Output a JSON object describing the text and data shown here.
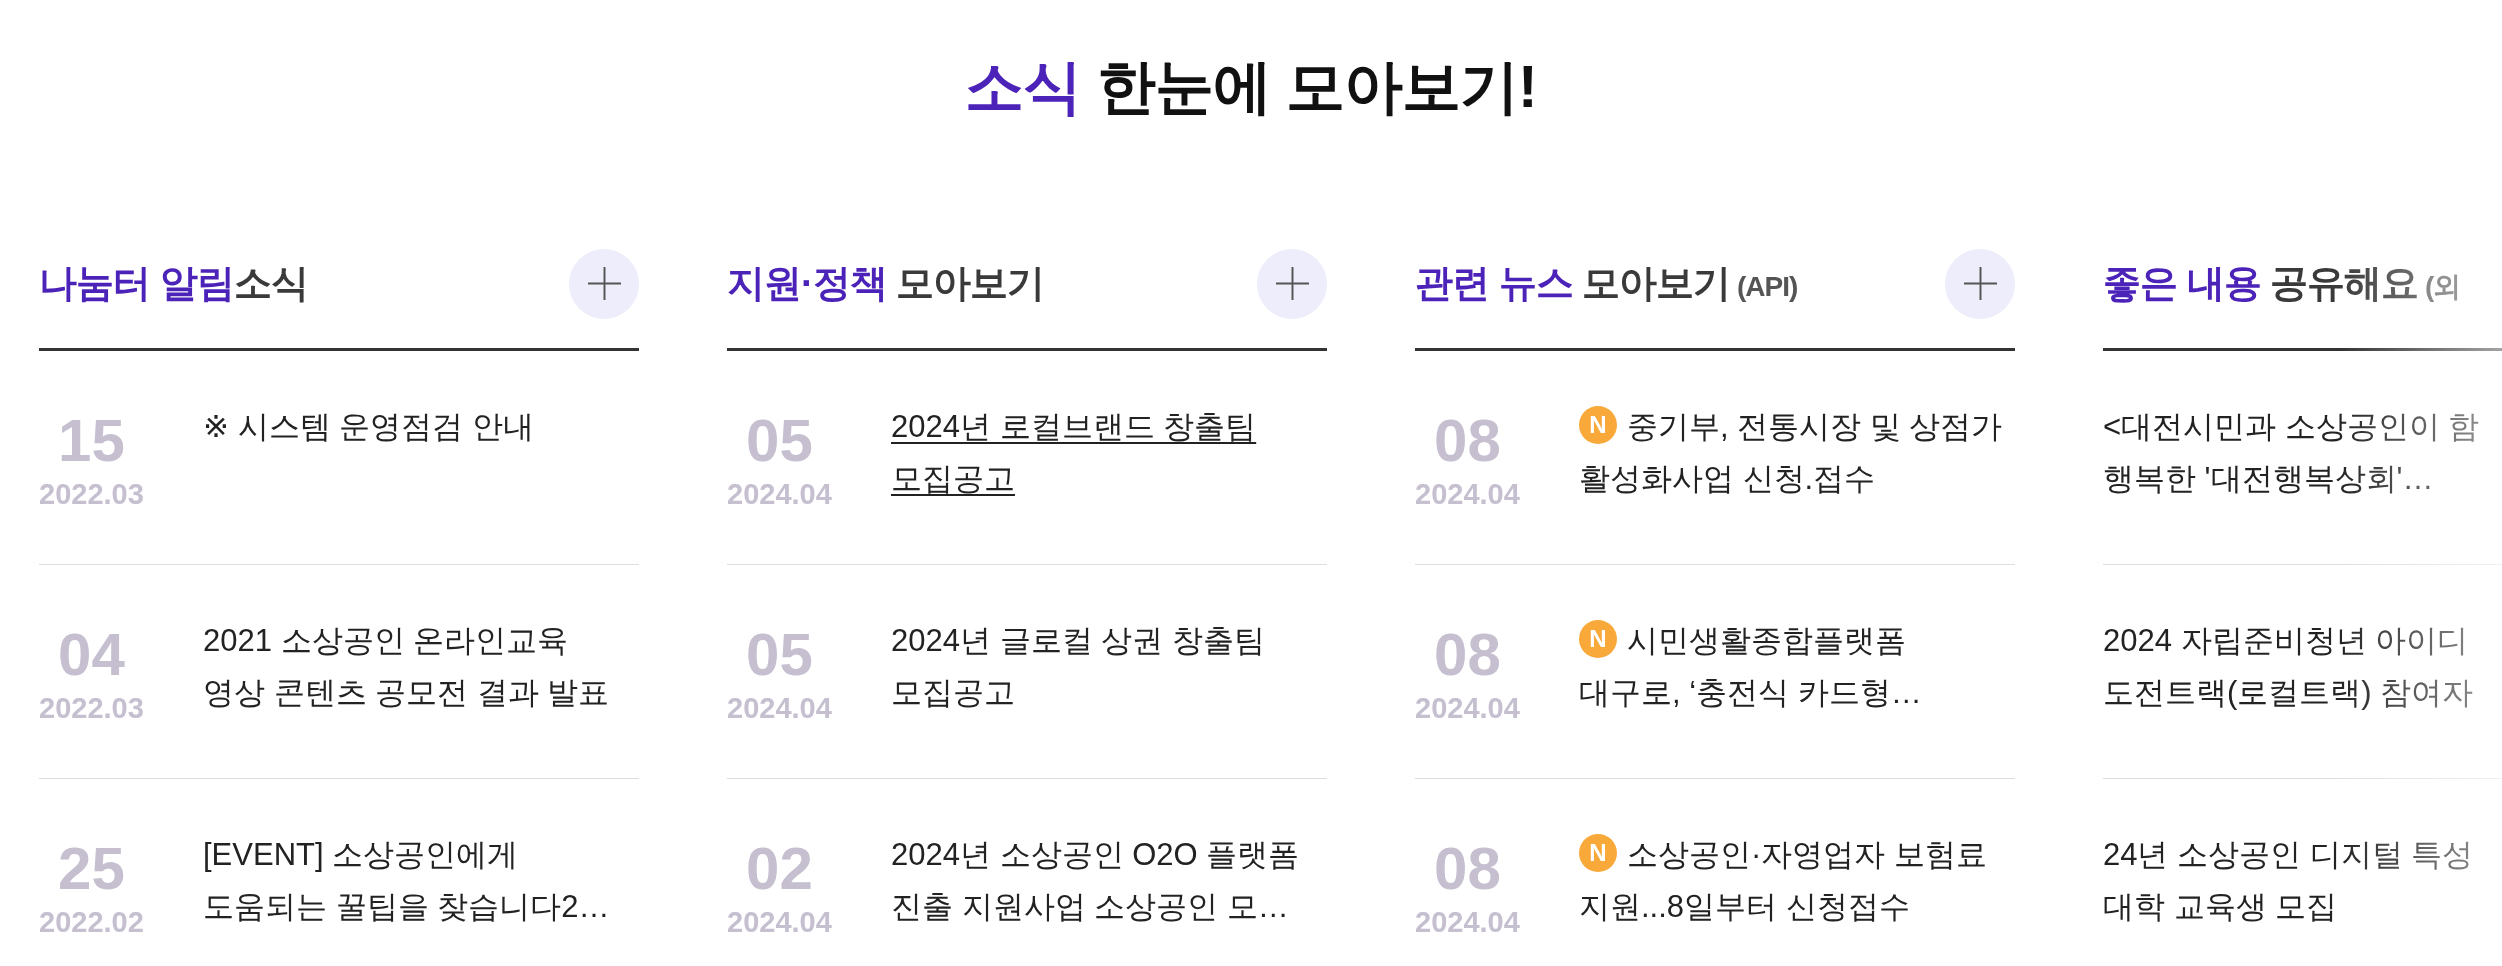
{
  "title": [
    {
      "text": "소식",
      "kind": "accent"
    },
    {
      "text": " 한눈에 모아보기!",
      "kind": "plain"
    }
  ],
  "columns": [
    {
      "heading": [
        {
          "text": "나눔터 알림",
          "kind": "accent"
        },
        {
          "text": "소식",
          "kind": "plain"
        }
      ],
      "more_button": true,
      "items": [
        {
          "day": "15",
          "month": "2022.03",
          "lines": [
            "※ 시스템 운영점검 안내"
          ],
          "hovered": false
        },
        {
          "day": "04",
          "month": "2022.03",
          "lines": [
            "2021 소상공인 온라인교육",
            "영상 콘텐츠 공모전 결과 발표"
          ],
          "hovered": false
        },
        {
          "day": "25",
          "month": "2022.02",
          "lines": [
            "[EVENT] 소상공인에게",
            "도움되는 꿀팁을 찾습니다2…"
          ],
          "hovered": false
        }
      ]
    },
    {
      "heading": [
        {
          "text": "지원·정책",
          "kind": "accent"
        },
        {
          "text": " 모아보기",
          "kind": "plain"
        }
      ],
      "more_button": true,
      "items": [
        {
          "day": "05",
          "month": "2024.04",
          "lines": [
            "2024년 로컬브랜드 창출팀",
            "모집공고"
          ],
          "hovered": true
        },
        {
          "day": "05",
          "month": "2024.04",
          "lines": [
            "2024년 글로컬 상권 창출팀",
            "모집공고"
          ],
          "hovered": false
        },
        {
          "day": "02",
          "month": "2024.04",
          "lines": [
            "2024년 소상공인 O2O 플랫폼",
            "진출 지원사업 소상공인 모…"
          ],
          "hovered": false
        }
      ]
    },
    {
      "heading": [
        {
          "text": "관련 뉴스",
          "kind": "accent"
        },
        {
          "text": " 모아보기",
          "kind": "plain"
        },
        {
          "text": " (API)",
          "kind": "note"
        }
      ],
      "more_button": true,
      "items": [
        {
          "day": "08",
          "month": "2024.04",
          "badge": "N",
          "lines": [
            "중기부, 전통시장 및 상점가",
            "활성화사업 신청.접수"
          ],
          "hovered": false
        },
        {
          "day": "08",
          "month": "2024.04",
          "badge": "N",
          "lines": [
            "시민생활종합플랫폼",
            "대구로, ‘충전식 카드형…"
          ],
          "hovered": false
        },
        {
          "day": "08",
          "month": "2024.04",
          "badge": "N",
          "lines": [
            "소상공인·자영업자 보험료",
            "지원...8일부터 신청접수"
          ],
          "hovered": false
        }
      ]
    },
    {
      "heading": [
        {
          "text": "좋은 내용",
          "kind": "accent"
        },
        {
          "text": " 공유해요",
          "kind": "plain"
        },
        {
          "text": " (외",
          "kind": "note"
        }
      ],
      "items": [
        {
          "lines": [
            "<대전시민과 소상공인이 함",
            "행복한 '대전행복상회'…"
          ],
          "hovered": false
        },
        {
          "lines": [
            "2024 자립준비청년 아이디",
            "도전트랙(로컬트랙) 참여자"
          ],
          "hovered": false
        },
        {
          "lines": [
            "24년 소상공인 디지털 특성",
            "대학 교육생 모집"
          ],
          "hovered": false
        }
      ]
    }
  ]
}
